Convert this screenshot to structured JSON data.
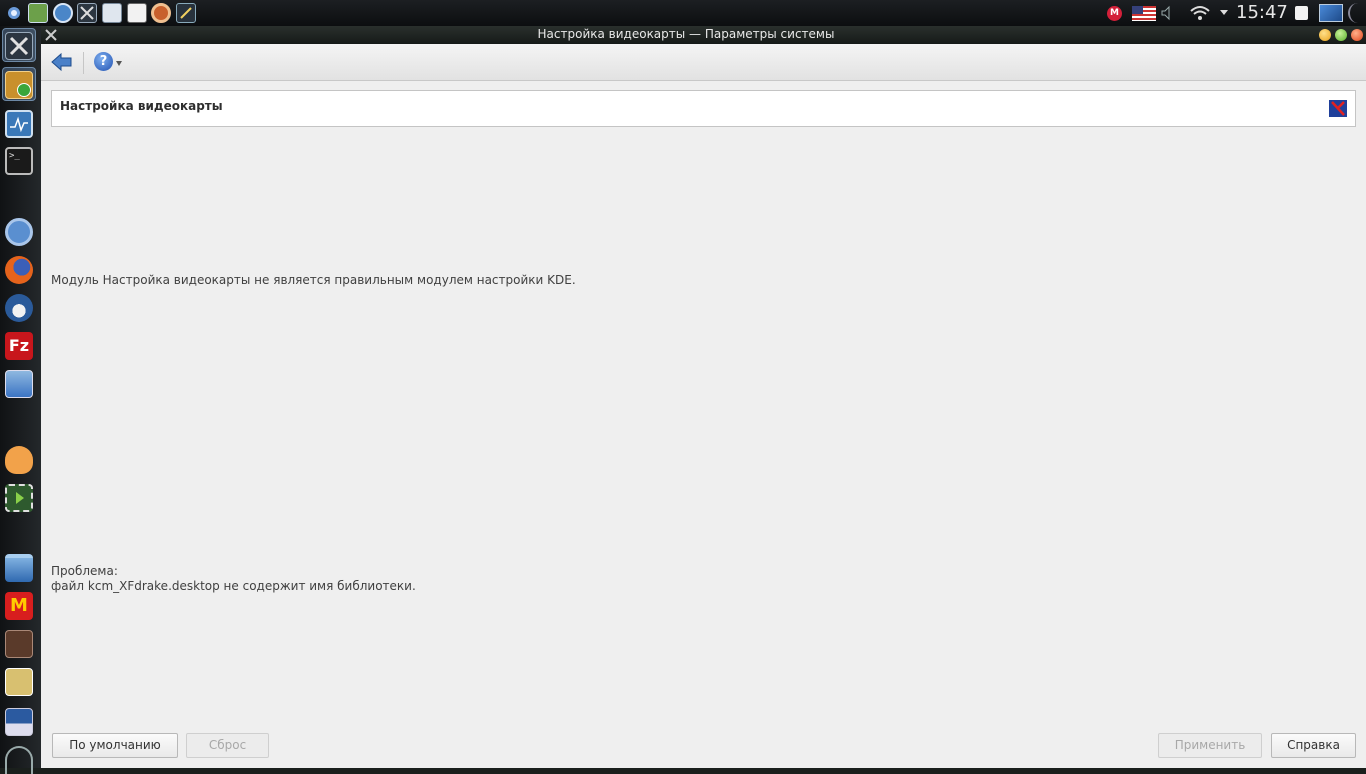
{
  "panel": {
    "clock": "15:47",
    "tray_badge": "M"
  },
  "window": {
    "title": "Настройка видеокарты — Параметры системы"
  },
  "header": {
    "title": "Настройка видеокарты"
  },
  "content": {
    "error_message": "Модуль Настройка видеокарты не является правильным модулем настройки KDE.",
    "problem_label": "Проблема:",
    "problem_detail": "файл kcm_XFdrake.desktop не содержит имя библиотеки."
  },
  "buttons": {
    "defaults": "По умолчанию",
    "reset": "Сброс",
    "apply": "Применить",
    "help": "Справка"
  },
  "colors": {
    "window_bg": "#efefef",
    "accent": "#3b74c4"
  }
}
